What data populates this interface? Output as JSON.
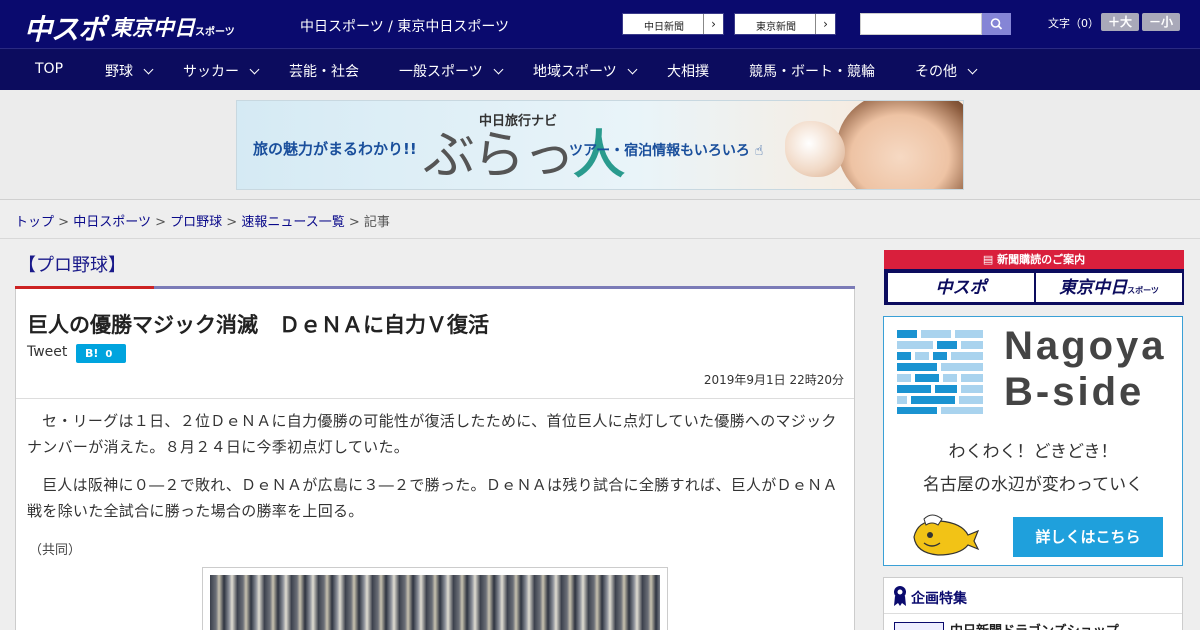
{
  "header": {
    "logo_main": "中スポ",
    "logo_tokyo": "東京中日",
    "logo_tokyo_sub": "スポーツ",
    "site_name": "中日スポーツ / 東京中日スポーツ",
    "ext_links": [
      "中日新聞",
      "東京新聞"
    ],
    "text_size_label": "文字（0）",
    "text_bigger": "＋大",
    "text_smaller": "－小"
  },
  "nav": {
    "items": [
      {
        "label": "TOP"
      },
      {
        "label": "野球"
      },
      {
        "label": "サッカー"
      },
      {
        "label": "芸能・社会"
      },
      {
        "label": "一般スポーツ"
      },
      {
        "label": "地域スポーツ"
      },
      {
        "label": "大相撲"
      },
      {
        "label": "競馬・ボート・競輪"
      },
      {
        "label": "その他"
      }
    ]
  },
  "banner": {
    "left_copy": "旅の魅力がまるわかり!!",
    "navi_label": "中日旅行ナビ",
    "logo_kana": "ぶらっ",
    "logo_kanji": "人",
    "right_copy": "ツアー・宿泊情報もいろいろ"
  },
  "breadcrumb": {
    "items": [
      "トップ",
      "中日スポーツ",
      "プロ野球",
      "速報ニュース一覧"
    ],
    "separator": ">",
    "current": "記事"
  },
  "article": {
    "category": "【プロ野球】",
    "headline": "巨人の優勝マジック消滅　ＤｅＮＡに自力Ｖ復活",
    "tweet_label": "Tweet",
    "hatena_label": "B!",
    "hatena_count": "0",
    "date": "2019年9月1日 22時20分",
    "paragraphs": [
      "セ・リーグは１日、２位ＤｅＮＡに自力優勝の可能性が復活したために、首位巨人に点灯していた優勝へのマジックナンバーが消えた。８月２４日に今季初点灯していた。",
      "巨人は阪神に０―２で敗れ、ＤｅＮＡが広島に３―２で勝った。ＤｅＮＡは残り試合に全勝すれば、巨人がＤｅＮＡ戦を除いた全試合に勝った場合の勝率を上回る。"
    ],
    "credit": "（共同）"
  },
  "sidebar": {
    "subscription_head": "新聞購読のご案内",
    "subscription_logos": [
      "中スポ",
      "東京中日"
    ],
    "subscription_logo_sub": "スポーツ",
    "nagoya_title_1": "Nagoya",
    "nagoya_title_2": "B-side",
    "nagoya_copy_1": "わくわく！どきどき！",
    "nagoya_copy_2": "名古屋の水辺が変わっていく",
    "nagoya_button": "詳しくはこちら",
    "feature_title": "企画特集",
    "feature_item": "中日新聞ドラゴンズショップ"
  },
  "colors": {
    "header_bg": "#0a0a6e",
    "nav_bg": "#0c0c5e",
    "accent_red": "#d91f3c",
    "accent_blue": "#1fa0dc"
  }
}
